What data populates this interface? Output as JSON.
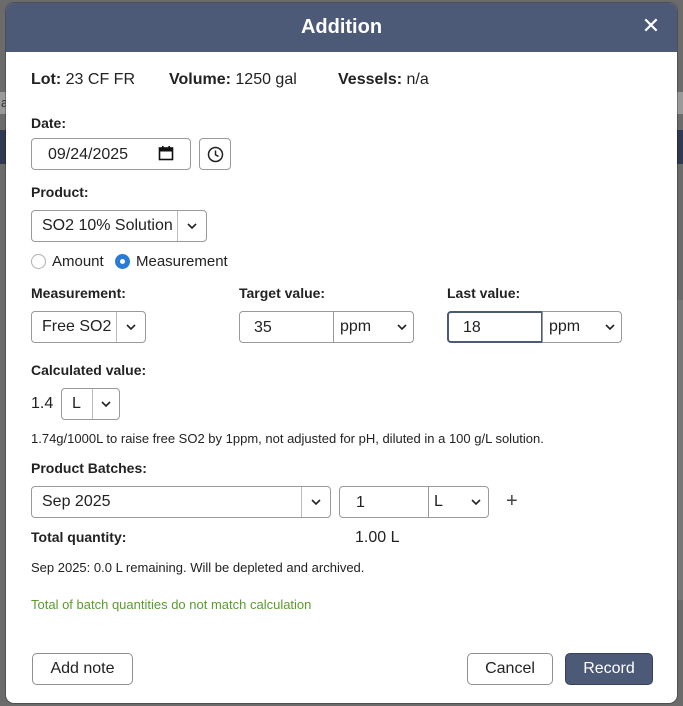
{
  "modal": {
    "title": "Addition"
  },
  "info": {
    "lot_label": "Lot:",
    "lot_value": "23 CF FR",
    "volume_label": "Volume:",
    "volume_value": "1250 gal",
    "vessels_label": "Vessels:",
    "vessels_value": "n/a"
  },
  "date": {
    "label": "Date:",
    "value": "09/24/2025"
  },
  "product": {
    "label": "Product:",
    "value": "SO2 10% Solution"
  },
  "mode": {
    "amount_label": "Amount",
    "measurement_label": "Measurement",
    "selected": "Measurement"
  },
  "measurement": {
    "label": "Measurement:",
    "value": "Free SO2"
  },
  "target": {
    "label": "Target value:",
    "value": "35",
    "unit": "ppm"
  },
  "last": {
    "label": "Last value:",
    "value": "18",
    "unit": "ppm"
  },
  "calculated": {
    "label": "Calculated value:",
    "value": "1.4",
    "unit": "L",
    "note": "1.74g/1000L to raise free SO2 by 1ppm, not adjusted for pH, diluted in a 100 g/L solution."
  },
  "batches": {
    "label": "Product Batches:",
    "batch": "Sep 2025",
    "quantity": "1",
    "unit": "L",
    "add_symbol": "+"
  },
  "total": {
    "label": "Total quantity:",
    "value": "1.00 L"
  },
  "remaining_note": "Sep 2025: 0.0 L remaining. Will be depleted and archived.",
  "mismatch_warning": "Total of batch quantities do not match calculation",
  "footer": {
    "add_note": "Add note",
    "cancel": "Cancel",
    "record": "Record"
  },
  "background": {
    "fragment": "a"
  },
  "colors": {
    "header": "#4c5a78",
    "warning": "#5b9b2f",
    "radio_on": "#2a7bd6"
  }
}
